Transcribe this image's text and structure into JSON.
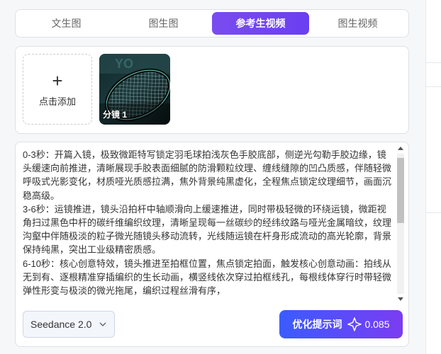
{
  "tabs": [
    {
      "label": "文生图",
      "active": false
    },
    {
      "label": "图生图",
      "active": false
    },
    {
      "label": "参考生视频",
      "active": true
    },
    {
      "label": "图生视频",
      "active": false
    }
  ],
  "reference": {
    "add_label": "点击添加",
    "add_icon": "+",
    "items": [
      {
        "label": "分镜 1",
        "icon": "badminton-racket-image"
      }
    ]
  },
  "prompt": {
    "text": "0-3秒：开篇入镜，极致微距特写锁定羽毛球拍浅灰色手胶底部，侧逆光勾勒手胶边缘，镜头缓速向前推进，清晰展现手胶表面细腻的防滑颗粒纹理、缠线缝隙的凹凸质感，伴随轻微呼吸式光影变化，材质哑光质感拉满，焦外背景纯黑虚化，全程焦点锁定纹理细节，画面沉稳高级。\n3-6秒：运镜推进，镜头沿拍杆中轴顺滑向上缓速推进，同时带极轻微的环绕运镜，微距视角扫过黑色中杆的碳纤维编织纹理，清晰呈现每一丝碳纱的经纬纹路与哑光金属暗纹，纹理沟壑中伴随极淡的粒子微光随镜头移动流转，光线随运镜在杆身形成流动的高光轮廓，背景保持纯黑，突出工业级精密质感。\n6-10秒：核心创意特效，镜头推进至拍框位置，焦点锁定拍面，触发核心创意动画：拍线从无到有、逐根精准穿插编织的生长动画，横竖线依次穿过拍框线孔，每根线体穿行时带轻微弹性形变与极淡的微光拖尾，编织过程丝滑有序，"
  },
  "model": {
    "label": "Seedance 2.0"
  },
  "optimize": {
    "label": "优化提示词",
    "cost": "0.085"
  },
  "colors": {
    "accent": "#6a3ff0",
    "button_gradient_start": "#3a5cff",
    "button_gradient_end": "#7b3cf2"
  }
}
